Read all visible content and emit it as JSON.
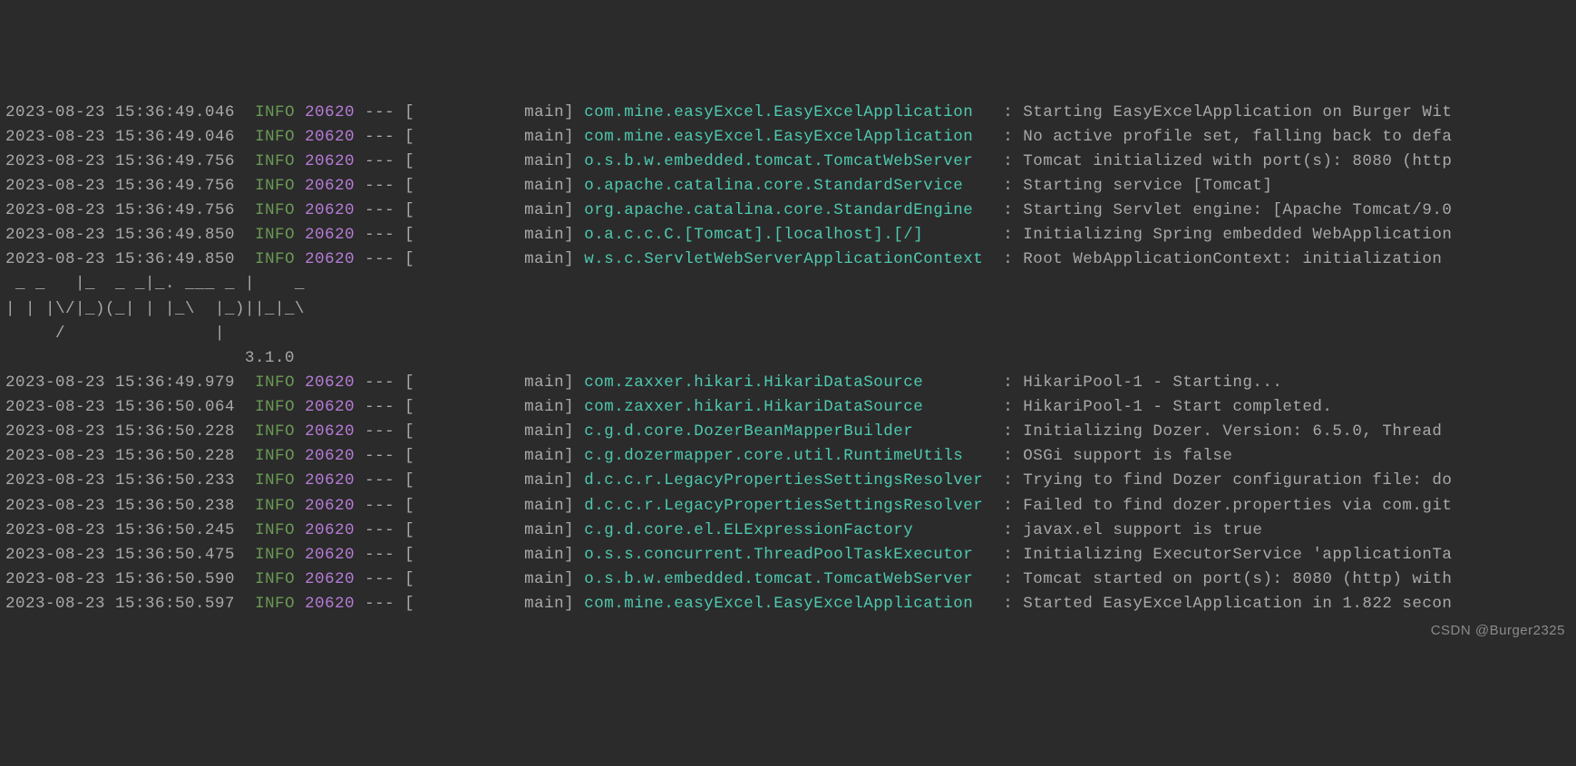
{
  "watermark": "CSDN @Burger2325",
  "ascii": {
    "l1": " _ _   |_  _ _|_. ___ _ |    _  ",
    "l2": "| | |\\/|_)(_| | |_\\  |_)||_|_\\ ",
    "l3": "     /               |         ",
    "l4": "                        3.1.0 "
  },
  "rows": [
    {
      "ts": "2023-08-23 15:36:49.046",
      "level": "INFO",
      "pid": "20620",
      "dashes": "---",
      "thread": "[           main]",
      "logger": "com.mine.easyExcel.EasyExcelApplication  ",
      "msg": ": Starting EasyExcelApplication on Burger Wit"
    },
    {
      "ts": "2023-08-23 15:36:49.046",
      "level": "INFO",
      "pid": "20620",
      "dashes": "---",
      "thread": "[           main]",
      "logger": "com.mine.easyExcel.EasyExcelApplication  ",
      "msg": ": No active profile set, falling back to defa"
    },
    {
      "ts": "2023-08-23 15:36:49.756",
      "level": "INFO",
      "pid": "20620",
      "dashes": "---",
      "thread": "[           main]",
      "logger": "o.s.b.w.embedded.tomcat.TomcatWebServer  ",
      "msg": ": Tomcat initialized with port(s): 8080 (http"
    },
    {
      "ts": "2023-08-23 15:36:49.756",
      "level": "INFO",
      "pid": "20620",
      "dashes": "---",
      "thread": "[           main]",
      "logger": "o.apache.catalina.core.StandardService   ",
      "msg": ": Starting service [Tomcat]"
    },
    {
      "ts": "2023-08-23 15:36:49.756",
      "level": "INFO",
      "pid": "20620",
      "dashes": "---",
      "thread": "[           main]",
      "logger": "org.apache.catalina.core.StandardEngine  ",
      "msg": ": Starting Servlet engine: [Apache Tomcat/9.0"
    },
    {
      "ts": "2023-08-23 15:36:49.850",
      "level": "INFO",
      "pid": "20620",
      "dashes": "---",
      "thread": "[           main]",
      "logger": "o.a.c.c.C.[Tomcat].[localhost].[/]       ",
      "msg": ": Initializing Spring embedded WebApplication"
    },
    {
      "ts": "2023-08-23 15:36:49.850",
      "level": "INFO",
      "pid": "20620",
      "dashes": "---",
      "thread": "[           main]",
      "logger": "w.s.c.ServletWebServerApplicationContext ",
      "msg": ": Root WebApplicationContext: initialization "
    }
  ],
  "rows2": [
    {
      "ts": "2023-08-23 15:36:49.979",
      "level": "INFO",
      "pid": "20620",
      "dashes": "---",
      "thread": "[           main]",
      "logger": "com.zaxxer.hikari.HikariDataSource       ",
      "msg": ": HikariPool-1 - Starting..."
    },
    {
      "ts": "2023-08-23 15:36:50.064",
      "level": "INFO",
      "pid": "20620",
      "dashes": "---",
      "thread": "[           main]",
      "logger": "com.zaxxer.hikari.HikariDataSource       ",
      "msg": ": HikariPool-1 - Start completed."
    },
    {
      "ts": "2023-08-23 15:36:50.228",
      "level": "INFO",
      "pid": "20620",
      "dashes": "---",
      "thread": "[           main]",
      "logger": "c.g.d.core.DozerBeanMapperBuilder        ",
      "msg": ": Initializing Dozer. Version: 6.5.0, Thread "
    },
    {
      "ts": "2023-08-23 15:36:50.228",
      "level": "INFO",
      "pid": "20620",
      "dashes": "---",
      "thread": "[           main]",
      "logger": "c.g.dozermapper.core.util.RuntimeUtils   ",
      "msg": ": OSGi support is false"
    },
    {
      "ts": "2023-08-23 15:36:50.233",
      "level": "INFO",
      "pid": "20620",
      "dashes": "---",
      "thread": "[           main]",
      "logger": "d.c.c.r.LegacyPropertiesSettingsResolver ",
      "msg": ": Trying to find Dozer configuration file: do"
    },
    {
      "ts": "2023-08-23 15:36:50.238",
      "level": "INFO",
      "pid": "20620",
      "dashes": "---",
      "thread": "[           main]",
      "logger": "d.c.c.r.LegacyPropertiesSettingsResolver ",
      "msg": ": Failed to find dozer.properties via com.git"
    },
    {
      "ts": "2023-08-23 15:36:50.245",
      "level": "INFO",
      "pid": "20620",
      "dashes": "---",
      "thread": "[           main]",
      "logger": "c.g.d.core.el.ELExpressionFactory        ",
      "msg": ": javax.el support is true"
    },
    {
      "ts": "2023-08-23 15:36:50.475",
      "level": "INFO",
      "pid": "20620",
      "dashes": "---",
      "thread": "[           main]",
      "logger": "o.s.s.concurrent.ThreadPoolTaskExecutor  ",
      "msg": ": Initializing ExecutorService 'applicationTa"
    },
    {
      "ts": "2023-08-23 15:36:50.590",
      "level": "INFO",
      "pid": "20620",
      "dashes": "---",
      "thread": "[           main]",
      "logger": "o.s.b.w.embedded.tomcat.TomcatWebServer  ",
      "msg": ": Tomcat started on port(s): 8080 (http) with"
    },
    {
      "ts": "2023-08-23 15:36:50.597",
      "level": "INFO",
      "pid": "20620",
      "dashes": "---",
      "thread": "[           main]",
      "logger": "com.mine.easyExcel.EasyExcelApplication  ",
      "msg": ": Started EasyExcelApplication in 1.822 secon"
    }
  ]
}
